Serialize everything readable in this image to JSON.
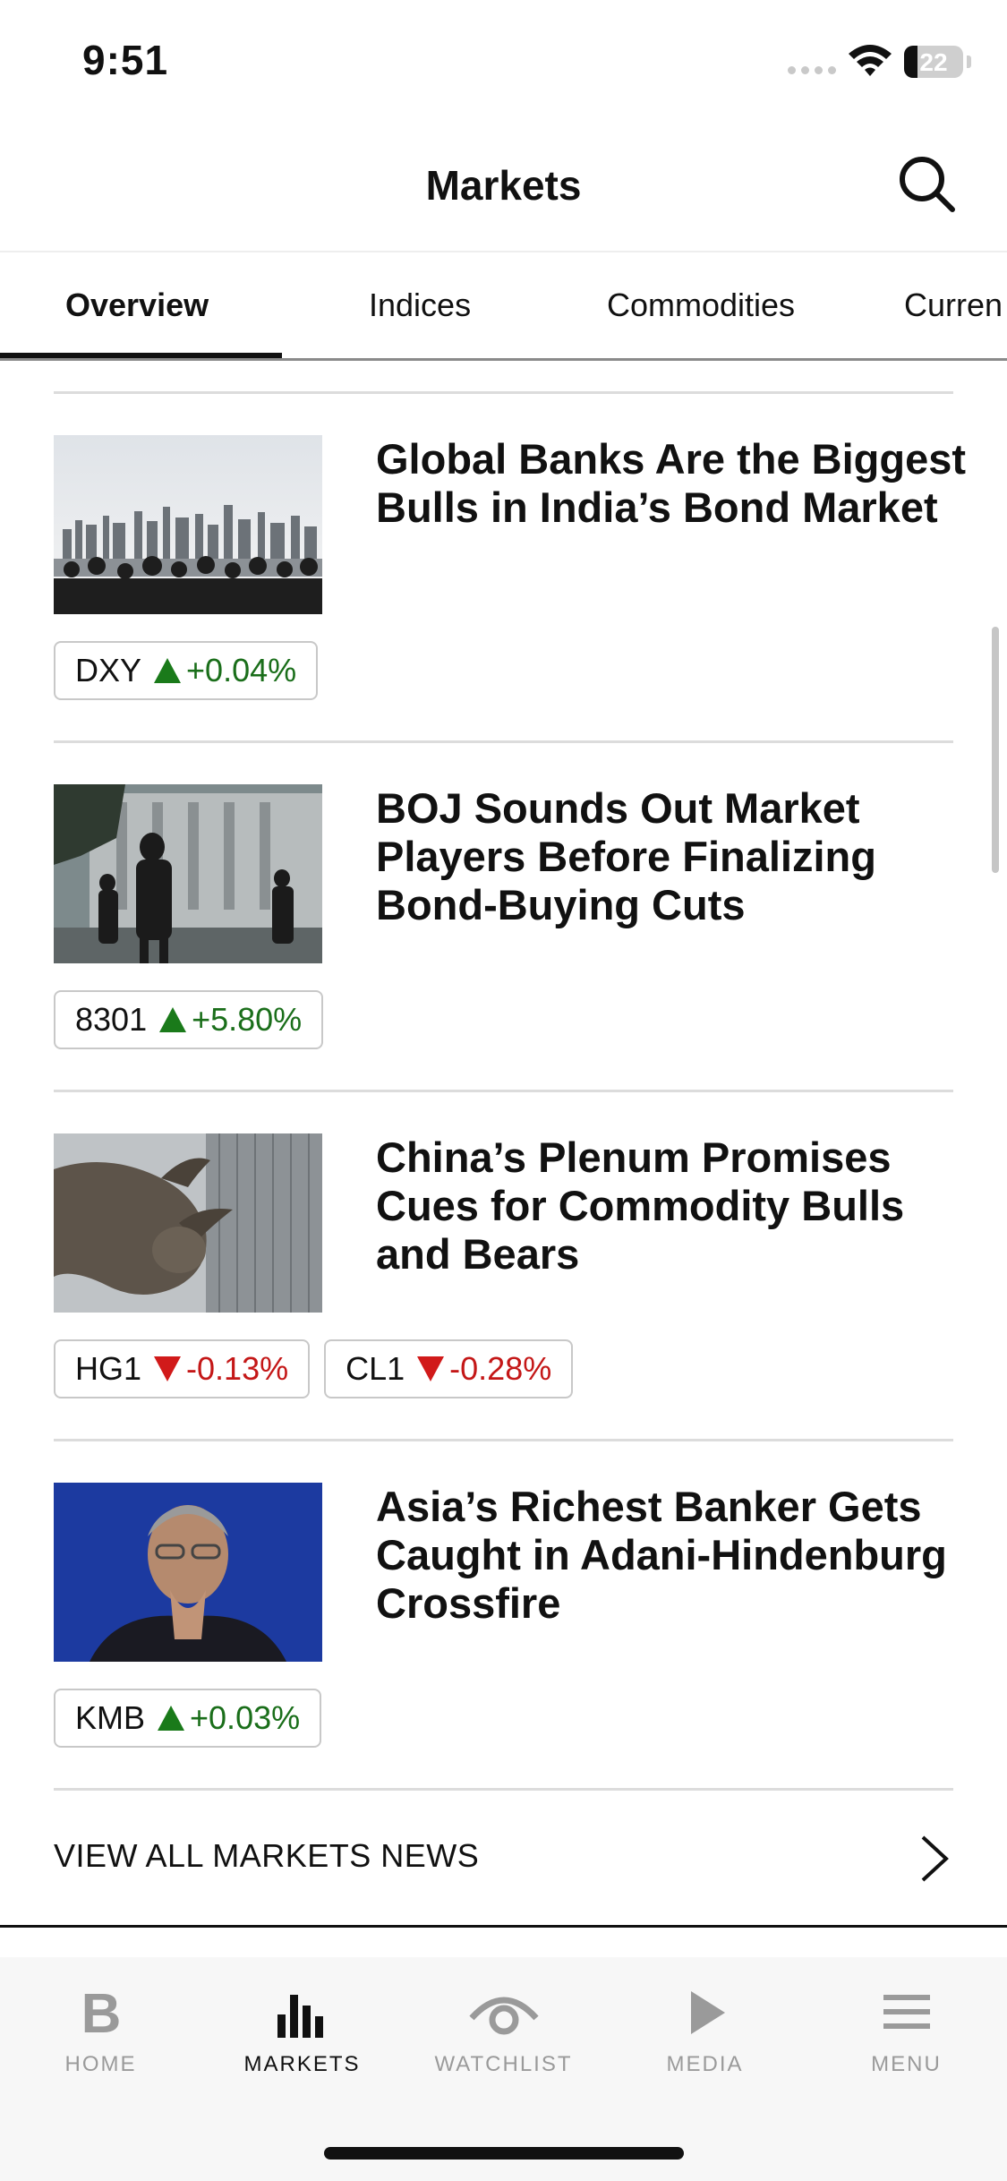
{
  "status_bar": {
    "time": "9:51",
    "battery": "22"
  },
  "header": {
    "title": "Markets"
  },
  "tabs": [
    {
      "label": "Overview",
      "active": true
    },
    {
      "label": "Indices",
      "active": false
    },
    {
      "label": "Commodities",
      "active": false
    },
    {
      "label": "Curren",
      "active": false
    }
  ],
  "articles": [
    {
      "headline": "Global Banks Are the Biggest Bulls in India’s Bond Market",
      "tickers": [
        {
          "symbol": "DXY",
          "direction": "up",
          "change": "+0.04%"
        }
      ]
    },
    {
      "headline": "BOJ Sounds Out Market Players Before Finalizing Bond-Buying Cuts",
      "tickers": [
        {
          "symbol": "8301",
          "direction": "up",
          "change": "+5.80%"
        }
      ]
    },
    {
      "headline": "China’s Plenum Promises Cues for Commodity Bulls and Bears",
      "tickers": [
        {
          "symbol": "HG1",
          "direction": "down",
          "change": "-0.13%"
        },
        {
          "symbol": "CL1",
          "direction": "down",
          "change": "-0.28%"
        }
      ]
    },
    {
      "headline": "Asia’s Richest Banker Gets Caught in Adani-Hindenburg Crossfire",
      "tickers": [
        {
          "symbol": "KMB",
          "direction": "up",
          "change": "+0.03%"
        }
      ]
    }
  ],
  "view_all": {
    "label": "VIEW ALL MARKETS NEWS"
  },
  "bottom_nav": [
    {
      "label": "HOME",
      "icon": "bloomberg-b-icon",
      "active": false
    },
    {
      "label": "MARKETS",
      "icon": "bar-chart-icon",
      "active": true
    },
    {
      "label": "WATCHLIST",
      "icon": "eye-icon",
      "active": false
    },
    {
      "label": "MEDIA",
      "icon": "play-icon",
      "active": false
    },
    {
      "label": "MENU",
      "icon": "hamburger-menu-icon",
      "active": false
    }
  ],
  "colors": {
    "up": "#1a7a1a",
    "down": "#d11a1a",
    "accent": "#111111"
  }
}
